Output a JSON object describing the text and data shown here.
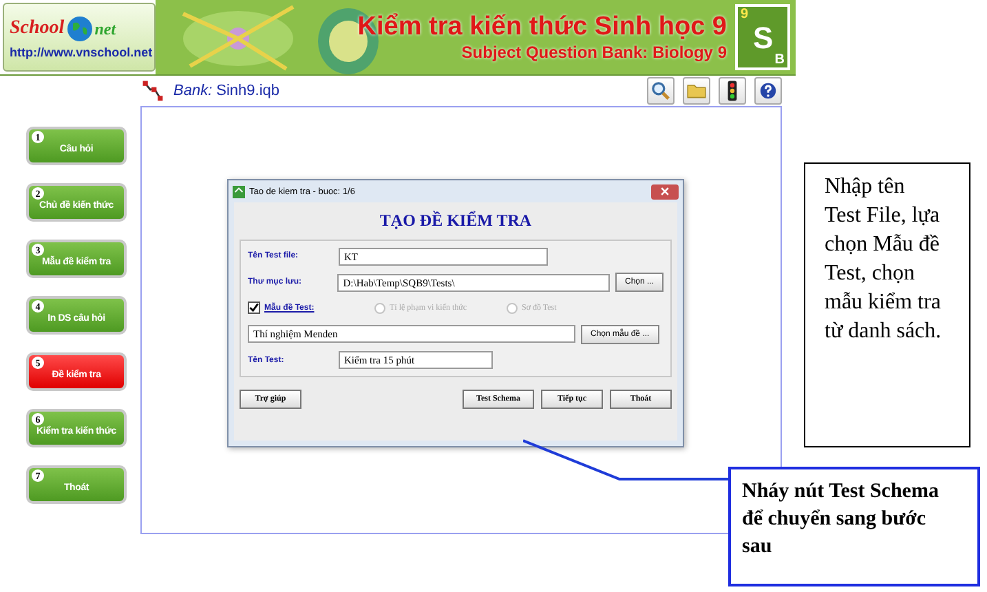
{
  "banner": {
    "logo_left": "School",
    "logo_right": "net",
    "url": "http://www.vnschool.net",
    "title": "Kiểm tra kiến thức Sinh học 9",
    "subtitle": "Subject Question Bank: Biology 9",
    "badge": {
      "number": "9",
      "letter": "S",
      "corner": "B"
    }
  },
  "toolbar": {
    "bank_label": "Bank:",
    "bank_file": "Sinh9.iqb"
  },
  "sidebar": {
    "items": [
      {
        "number": "1",
        "label": "Câu hỏi",
        "selected": false
      },
      {
        "number": "2",
        "label": "Chủ đề kiến thức",
        "selected": false
      },
      {
        "number": "3",
        "label": "Mẫu đề kiểm tra",
        "selected": false
      },
      {
        "number": "4",
        "label": "In DS câu hỏi",
        "selected": false
      },
      {
        "number": "5",
        "label": "Đề kiểm tra",
        "selected": true
      },
      {
        "number": "6",
        "label": "Kiểm tra kiến thức",
        "selected": false
      },
      {
        "number": "7",
        "label": "Thoát",
        "selected": false
      }
    ]
  },
  "dialog": {
    "title": "Tao de kiem tra - buoc: 1/6",
    "heading": "TẠO ĐỀ KIỂM TRA",
    "file_label": "Tên Test file:",
    "file_value": "KT",
    "folder_label": "Thư mục lưu:",
    "folder_value": "D:\\Hab\\Temp\\SQB9\\Tests\\",
    "folder_button": "Chọn ...",
    "template_checkbox": {
      "label": "Mẫu đề Test:",
      "checked": true
    },
    "options": [
      {
        "label": "Tỉ lệ phạm vi kiến thức",
        "selected": false,
        "disabled": true
      },
      {
        "label": "Sơ đồ Test",
        "selected": false,
        "disabled": true
      }
    ],
    "template_value": "Thí nghiệm Menden",
    "template_button": "Chọn mẫu đề ...",
    "name_label": "Tên Test:",
    "name_value": "Kiểm tra 15 phút",
    "buttons": [
      "Trợ giúp",
      "Test Schema",
      "Tiếp tục",
      "Thoát"
    ]
  },
  "note": "Nhập tên Test File, lựa chọn Mẫu đề Test, chọn mẫu kiểm tra từ danh sách.",
  "callout": "Nháy nút Test Schema để chuyển sang bước sau"
}
